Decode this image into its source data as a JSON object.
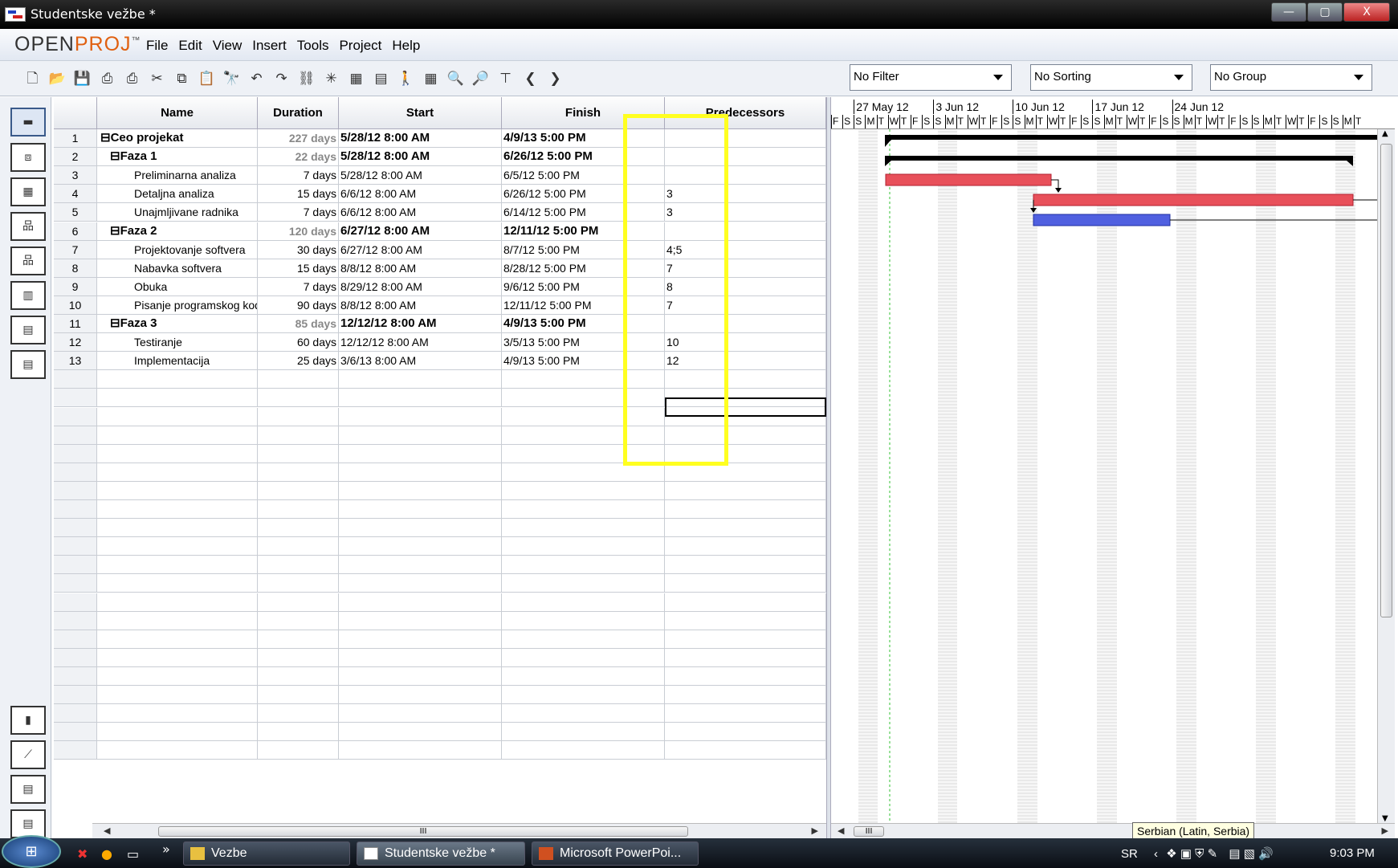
{
  "window": {
    "title": "Studentske vežbe *",
    "btn_min": "—",
    "btn_max": "▢",
    "btn_close": "X"
  },
  "logo": {
    "part1": "OPEN",
    "part2": "PROJ",
    "mark": "™"
  },
  "menu": [
    "File",
    "Edit",
    "View",
    "Insert",
    "Tools",
    "Project",
    "Help"
  ],
  "filters": {
    "filter": "No Filter",
    "sorting": "No Sorting",
    "group": "No Group"
  },
  "columns": {
    "name": "Name",
    "duration": "Duration",
    "start": "Start",
    "finish": "Finish",
    "predecessors": "Predecessors"
  },
  "tasks": [
    {
      "id": "1",
      "name": "Ceo projekat",
      "duration": "227 days",
      "start": "5/28/12 8:00 AM",
      "finish": "4/9/13 5:00 PM",
      "predecessors": "",
      "summary": true,
      "level": 0
    },
    {
      "id": "2",
      "name": "Faza 1",
      "duration": "22 days",
      "start": "5/28/12 8:00 AM",
      "finish": "6/26/12 5:00 PM",
      "predecessors": "",
      "summary": true,
      "level": 1
    },
    {
      "id": "3",
      "name": "Preliminarna analiza",
      "duration": "7 days",
      "start": "5/28/12 8:00 AM",
      "finish": "6/5/12 5:00 PM",
      "predecessors": "",
      "summary": false,
      "level": 2
    },
    {
      "id": "4",
      "name": "Detaljna analiza",
      "duration": "15 days",
      "start": "6/6/12 8:00 AM",
      "finish": "6/26/12 5:00 PM",
      "predecessors": "3",
      "summary": false,
      "level": 2
    },
    {
      "id": "5",
      "name": "Unajmljivane radnika",
      "duration": "7 days",
      "start": "6/6/12 8:00 AM",
      "finish": "6/14/12 5:00 PM",
      "predecessors": "3",
      "summary": false,
      "level": 2
    },
    {
      "id": "6",
      "name": "Faza 2",
      "duration": "120 days",
      "start": "6/27/12 8:00 AM",
      "finish": "12/11/12 5:00 PM",
      "predecessors": "",
      "summary": true,
      "level": 1
    },
    {
      "id": "7",
      "name": "Projektovanje softvera",
      "duration": "30 days",
      "start": "6/27/12 8:00 AM",
      "finish": "8/7/12 5:00 PM",
      "predecessors": "4;5",
      "summary": false,
      "level": 2
    },
    {
      "id": "8",
      "name": "Nabavka softvera",
      "duration": "15 days",
      "start": "8/8/12 8:00 AM",
      "finish": "8/28/12 5:00 PM",
      "predecessors": "7",
      "summary": false,
      "level": 2
    },
    {
      "id": "9",
      "name": "Obuka",
      "duration": "7 days",
      "start": "8/29/12 8:00 AM",
      "finish": "9/6/12 5:00 PM",
      "predecessors": "8",
      "summary": false,
      "level": 2
    },
    {
      "id": "10",
      "name": "Pisanje programskog kod",
      "duration": "90 days",
      "start": "8/8/12 8:00 AM",
      "finish": "12/11/12 5:00 PM",
      "predecessors": "7",
      "summary": false,
      "level": 2
    },
    {
      "id": "11",
      "name": "Faza 3",
      "duration": "85 days",
      "start": "12/12/12 8:00 AM",
      "finish": "4/9/13 5:00 PM",
      "predecessors": "",
      "summary": true,
      "level": 1
    },
    {
      "id": "12",
      "name": "Testiranje",
      "duration": "60 days",
      "start": "12/12/12 8:00 AM",
      "finish": "3/5/13 5:00 PM",
      "predecessors": "10",
      "summary": false,
      "level": 2
    },
    {
      "id": "13",
      "name": "Implementacija",
      "duration": "25 days",
      "start": "3/6/13 8:00 AM",
      "finish": "4/9/13 5:00 PM",
      "predecessors": "12",
      "summary": false,
      "level": 2
    }
  ],
  "timescale": {
    "weeks": [
      "27 May 12",
      "3 Jun 12",
      "10 Jun 12",
      "17 Jun 12",
      "24 Jun 12"
    ],
    "days": [
      "F",
      "S",
      "S",
      "M",
      "T",
      "W",
      "T",
      "F",
      "S",
      "S",
      "M",
      "T",
      "W",
      "T",
      "F",
      "S",
      "S",
      "M",
      "T",
      "W",
      "T",
      "F",
      "S",
      "S",
      "M",
      "T",
      "W",
      "T",
      "F",
      "S",
      "S",
      "M",
      "T",
      "W",
      "T",
      "F",
      "S",
      "S",
      "M",
      "T",
      "W",
      "T",
      "F",
      "S",
      "S",
      "M",
      "T"
    ]
  },
  "tooltip": "Serbian (Latin, Serbia)",
  "scroll": {
    "thumb": "III"
  },
  "taskbar": {
    "start": "⊞",
    "overflow": "»",
    "items": [
      {
        "label": "Vezbe",
        "active": false
      },
      {
        "label": "Studentske vežbe *",
        "active": true
      },
      {
        "label": "Microsoft PowerPoi...",
        "active": false
      }
    ],
    "lang": "SR",
    "clock": "9:03 PM"
  },
  "colors": {
    "critical_bar": "#e8505a",
    "normal_bar": "#5060e0",
    "summary_bar": "#000000",
    "highlight": "#ffff20"
  }
}
